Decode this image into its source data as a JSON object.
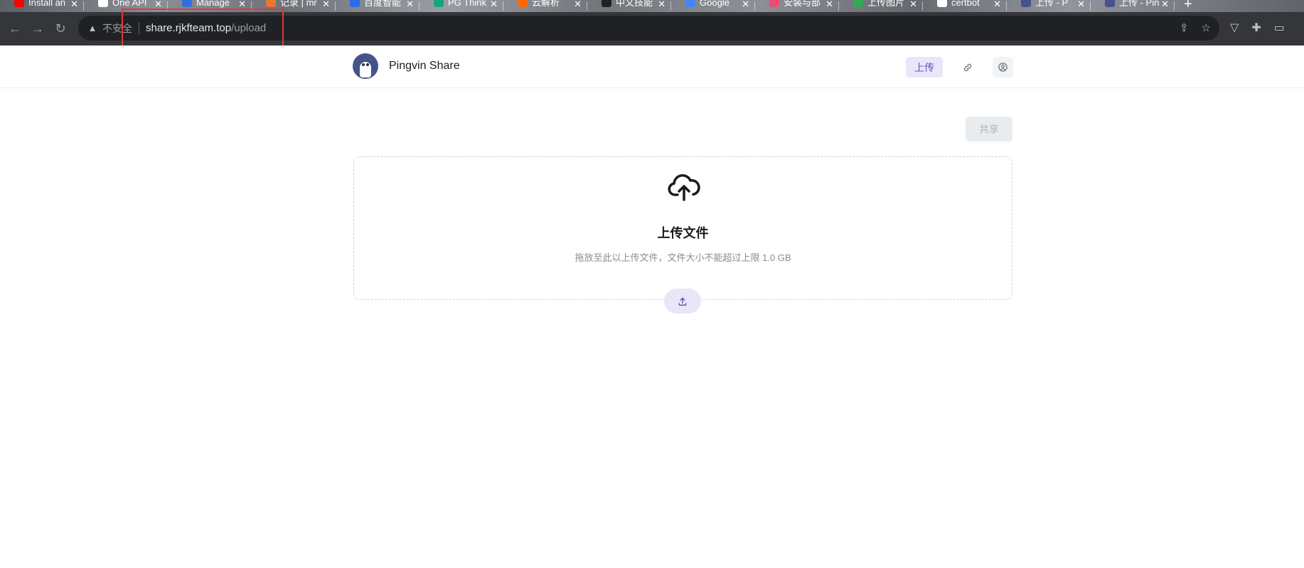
{
  "browser": {
    "tabs": [
      {
        "label": "Install an",
        "color": "#ff0000"
      },
      {
        "label": "One API",
        "color": "#ffffff"
      },
      {
        "label": "Manage",
        "color": "#2f6fe0"
      },
      {
        "label": "记录 | mr",
        "color": "#e8772e"
      },
      {
        "label": "百度智能",
        "color": "#2b6de8"
      },
      {
        "label": "PG Think",
        "color": "#19a37f"
      },
      {
        "label": "云解析",
        "color": "#ff6a00"
      },
      {
        "label": "中文技能",
        "color": "#222222"
      },
      {
        "label": "Google",
        "color": "#4285f4"
      },
      {
        "label": "安装与部",
        "color": "#e94e77"
      },
      {
        "label": "上传图片",
        "color": "#34a853"
      },
      {
        "label": "certbot",
        "color": "#ffffff"
      },
      {
        "label": "上传 - P",
        "color": "#46528a"
      },
      {
        "label": "上传 - Pin",
        "color": "#46528a"
      }
    ],
    "insecure_label": "不安全",
    "url_host": "share.rjkfteam.top",
    "url_path": "/upload"
  },
  "header": {
    "brand": "Pingvin Share",
    "nav_upload": "上传"
  },
  "main": {
    "share_button": "共享",
    "dropzone_title": "上传文件",
    "dropzone_subtitle": "拖放至此以上传文件，文件大小不能超过上限 1.0 GB"
  }
}
